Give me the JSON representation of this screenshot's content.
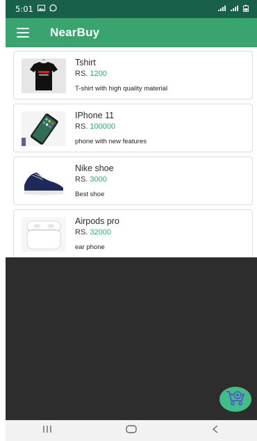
{
  "status_bar": {
    "time": "5:01",
    "icons": [
      "gallery-icon",
      "whatsapp-icon",
      "signal-icon",
      "wifi-icon",
      "battery-icon"
    ]
  },
  "app_bar": {
    "title": "NearBuy",
    "menu_icon": "hamburger-menu-icon"
  },
  "products": [
    {
      "name": "Tshirt",
      "price_prefix": "RS.",
      "price": "1200",
      "description": "T-shirt with high quality material",
      "image": "tshirt"
    },
    {
      "name": "IPhone 11",
      "price_prefix": "RS.",
      "price": "100000",
      "description": "phone with new features",
      "image": "phone"
    },
    {
      "name": "Nike shoe",
      "price_prefix": "RS.",
      "price": "3000",
      "description": "Best shoe",
      "image": "shoe"
    },
    {
      "name": "Airpods pro",
      "price_prefix": "RS.",
      "price": "32000",
      "description": "ear phone",
      "image": "airpods"
    }
  ],
  "fab": {
    "icon": "cart-add-icon"
  },
  "nav_bar": {
    "buttons": [
      "recent-apps-icon",
      "home-icon",
      "back-icon"
    ]
  },
  "colors": {
    "status_bar": "#19604a",
    "app_bar": "#3aa46f",
    "price": "#3aa46f",
    "fab": "#3fbf86",
    "dark_area": "#2d2d2d"
  }
}
